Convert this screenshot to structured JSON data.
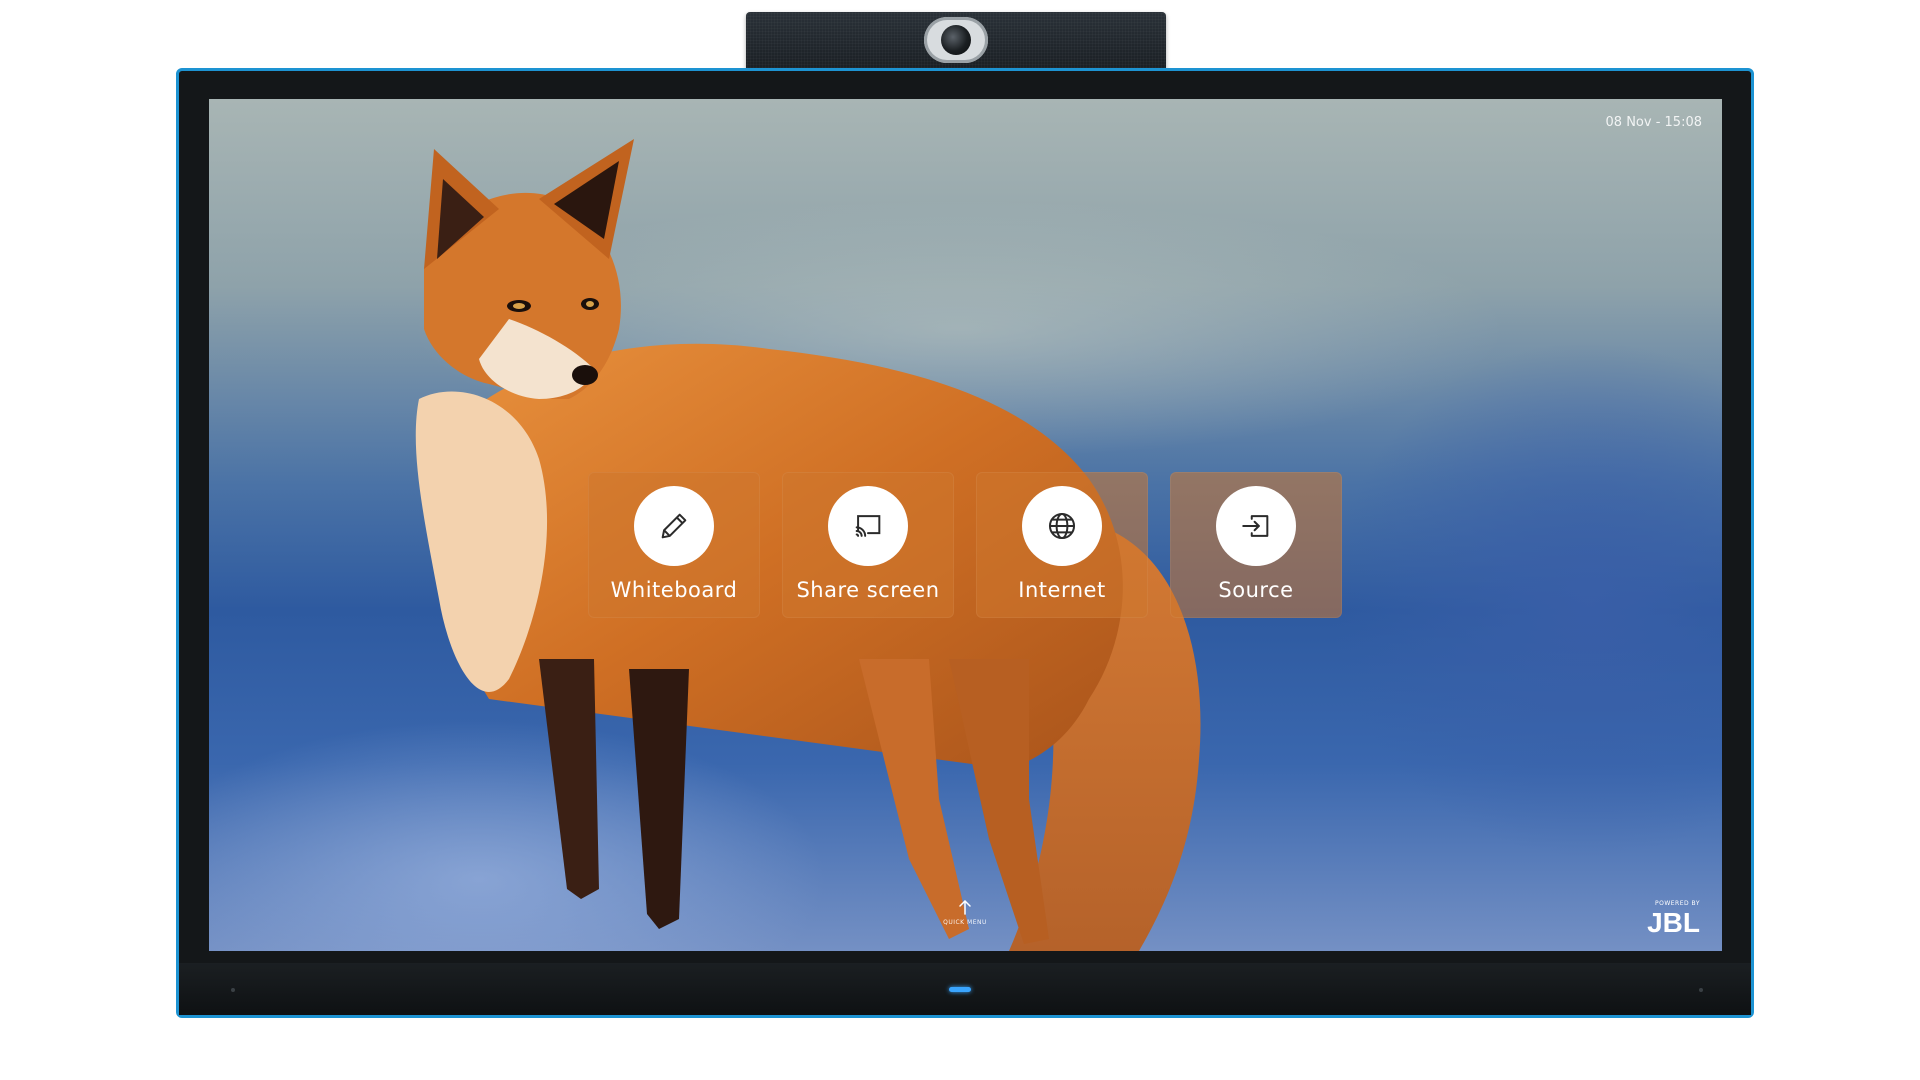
{
  "camera": {
    "label": ""
  },
  "screen": {
    "status": {
      "date_time": "08 Nov - 15:08"
    },
    "tiles": [
      {
        "label": "Whiteboard",
        "icon": "pencil-icon"
      },
      {
        "label": "Share screen",
        "icon": "cast-screen-icon"
      },
      {
        "label": "Internet",
        "icon": "globe-icon"
      },
      {
        "label": "Source",
        "icon": "input-source-icon"
      }
    ],
    "quick_menu": {
      "label": "QUICK MENU",
      "icon": "arrow-up-icon"
    },
    "powered_by": {
      "label": "POWERED BY",
      "brand": "JBL"
    }
  },
  "bezel": {
    "brand": ""
  },
  "colors": {
    "frame_accent": "#1d93d2",
    "tile_background": "rgba(205,118,45,0.55)",
    "led": "#3aa5ff"
  }
}
